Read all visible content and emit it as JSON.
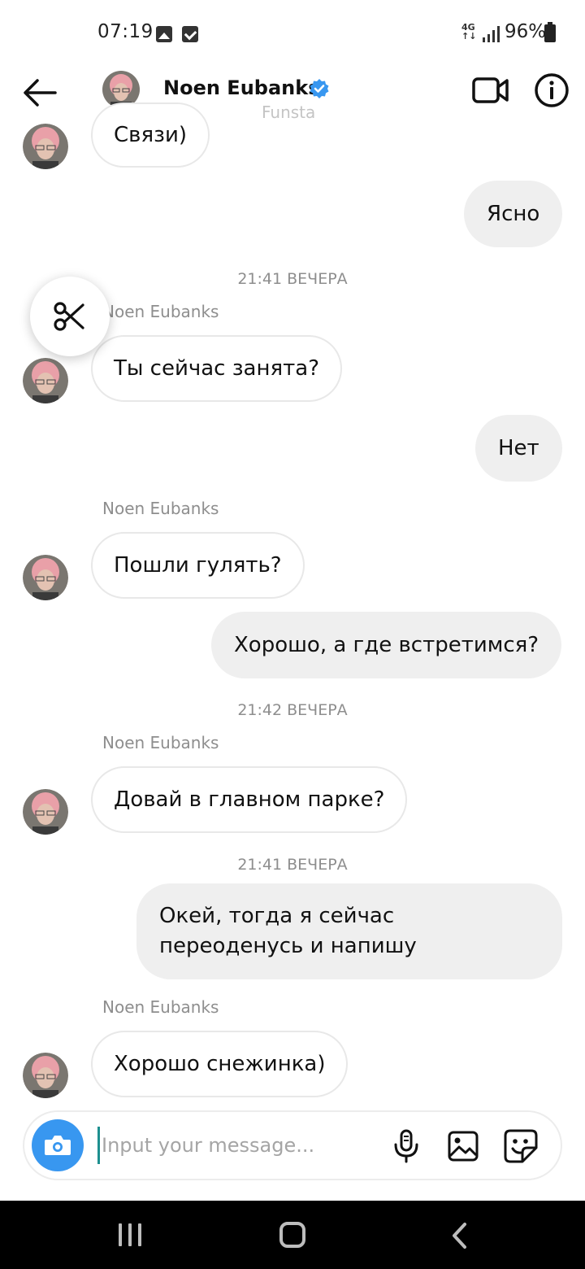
{
  "status_bar": {
    "time": "07:19",
    "network": "4G",
    "battery": "96%",
    "icons": [
      "photo-icon",
      "check-icon",
      "signal-icon",
      "battery-icon"
    ]
  },
  "header": {
    "title": "Noen Eubanks",
    "watermark": "Funsta",
    "icons": [
      "back-arrow-icon",
      "verified-icon",
      "video-call-icon",
      "info-icon"
    ],
    "verified_color": "#3897f0"
  },
  "messages": [
    {
      "type": "incoming",
      "text": "Связи)"
    },
    {
      "type": "outgoing",
      "text": "Ясно"
    },
    {
      "type": "timestamp",
      "text": "21:41 ВЕЧЕРА"
    },
    {
      "type": "sender",
      "text": "Noen Eubanks"
    },
    {
      "type": "incoming",
      "text": "Ты сейчас занята?"
    },
    {
      "type": "outgoing",
      "text": "Нет"
    },
    {
      "type": "sender",
      "text": "Noen Eubanks"
    },
    {
      "type": "incoming",
      "text": "Пошли гулять?"
    },
    {
      "type": "outgoing",
      "text": "Хорошо, а где встретимся?"
    },
    {
      "type": "timestamp",
      "text": "21:42 ВЕЧЕРА"
    },
    {
      "type": "sender",
      "text": "Noen Eubanks"
    },
    {
      "type": "incoming",
      "text": "Довай в главном парке?"
    },
    {
      "type": "timestamp",
      "text": "21:41 ВЕЧЕРА"
    },
    {
      "type": "outgoing",
      "lines": [
        "Окей, тогда я сейчас",
        "переоденусь и напишу"
      ]
    },
    {
      "type": "sender",
      "text": "Noen Eubanks"
    },
    {
      "type": "incoming",
      "text": "Хорошо снежинка)"
    }
  ],
  "composer": {
    "placeholder": "Input your message...",
    "value": "",
    "icons": [
      "camera-icon",
      "microphone-icon",
      "gallery-icon",
      "sticker-icon"
    ],
    "camera_color": "#3897f0"
  },
  "floating_tool": {
    "icon": "scissors-icon"
  },
  "nav_bar": {
    "icons": [
      "recent-apps-icon",
      "home-icon",
      "nav-back-icon"
    ]
  }
}
